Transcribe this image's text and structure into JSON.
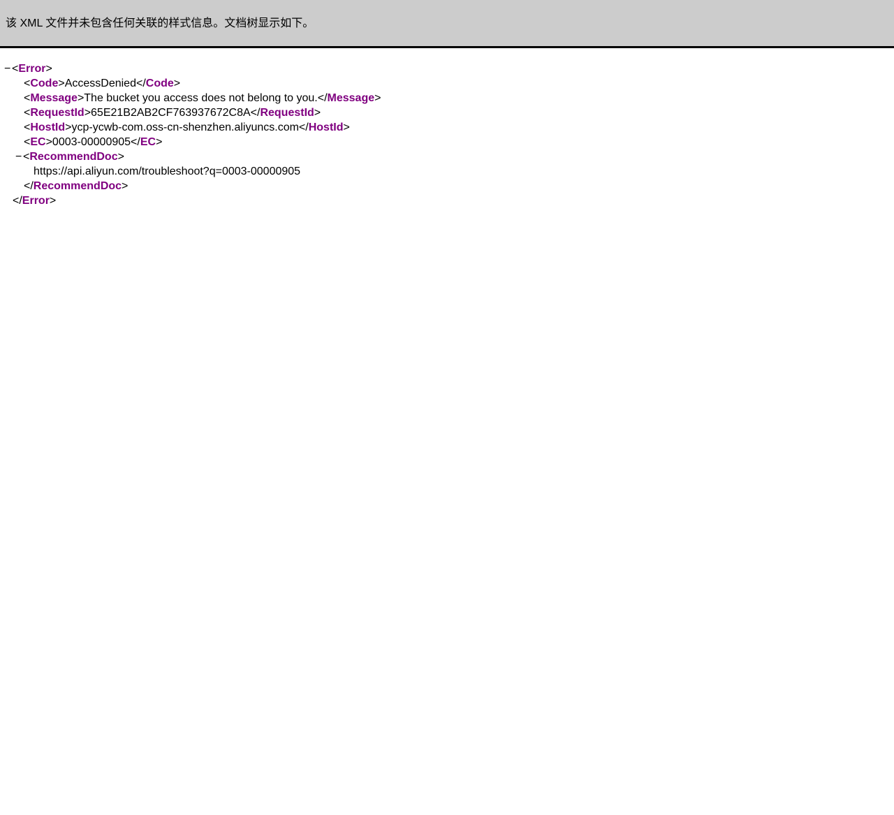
{
  "banner": {
    "message": "该 XML 文件并未包含任何关联的样式信息。文档树显示如下。"
  },
  "toggle_symbol": "−",
  "xml": {
    "root_tag": "Error",
    "code": {
      "tag": "Code",
      "value": "AccessDenied"
    },
    "message": {
      "tag": "Message",
      "value": "The bucket you access does not belong to you."
    },
    "request_id": {
      "tag": "RequestId",
      "value": "65E21B2AB2CF763937672C8A"
    },
    "host_id": {
      "tag": "HostId",
      "value": "ycp-ycwb-com.oss-cn-shenzhen.aliyuncs.com"
    },
    "ec": {
      "tag": "EC",
      "value": "0003-00000905"
    },
    "recommend_doc": {
      "tag": "RecommendDoc",
      "value": "https://api.aliyun.com/troubleshoot?q=0003-00000905"
    }
  },
  "colors": {
    "banner_background": "#cccccc",
    "tag_name": "#800080",
    "text": "#000000"
  }
}
